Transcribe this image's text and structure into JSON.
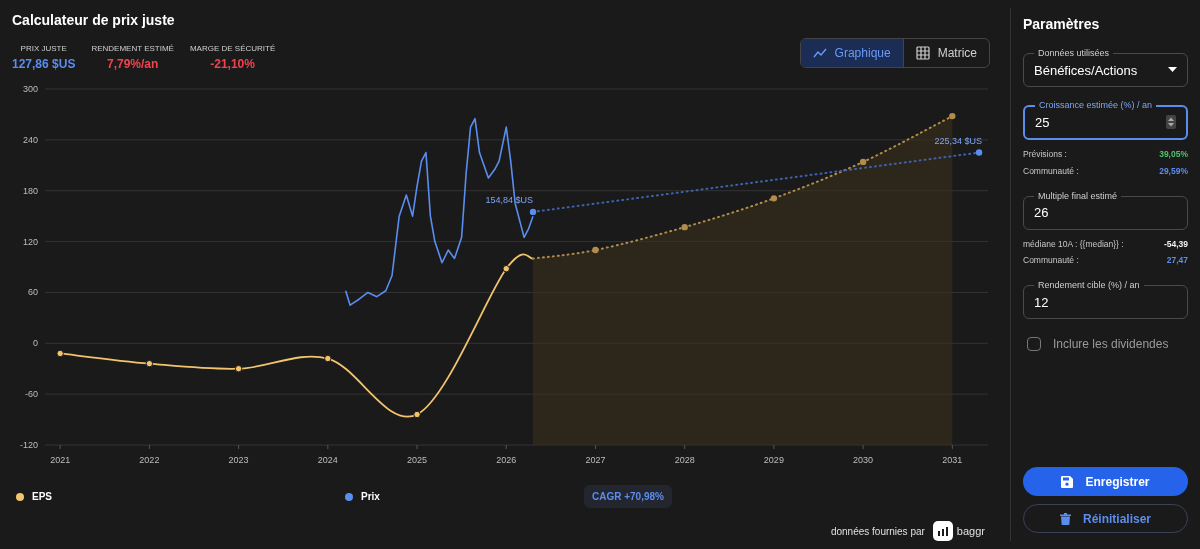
{
  "title": "Calculateur de prix juste",
  "metrics": [
    {
      "label": "PRIX JUSTE",
      "value": "127,86 $US",
      "color": "#5b8def"
    },
    {
      "label": "RENDEMENT ESTIMÉ",
      "value": "7,79%/an",
      "color": "#f0434b"
    },
    {
      "label": "MARGE DE SÉCURITÉ",
      "value": "-21,10%",
      "color": "#f0434b"
    }
  ],
  "view_toggle": [
    {
      "label": "Graphique",
      "kind": "chart",
      "selected": true
    },
    {
      "label": "Matrice",
      "kind": "grid",
      "selected": false
    }
  ],
  "chart_data": {
    "type": "line",
    "grid": true,
    "xlim": [
      2020.83,
      2031.4
    ],
    "ylim": [
      -120,
      300
    ],
    "xticks": [
      2021,
      2022,
      2023,
      2024,
      2025,
      2026,
      2027,
      2028,
      2029,
      2030,
      2031
    ],
    "yticks": [
      -120,
      -60,
      0,
      60,
      120,
      180,
      240,
      300
    ],
    "series": [
      {
        "name": "EPS",
        "color": "#f2c46d",
        "marker": true,
        "x": [
          2021,
          2022,
          2023,
          2024,
          2025,
          2026,
          2026.3
        ],
        "values": [
          -12,
          -24,
          -30,
          -18,
          -84,
          88,
          100
        ]
      },
      {
        "name": "Prix",
        "color": "#5b8def",
        "x": [
          2024.2,
          2024.25,
          2024.35,
          2024.45,
          2024.55,
          2024.65,
          2024.72,
          2024.8,
          2024.88,
          2024.95,
          2025.0,
          2025.05,
          2025.1,
          2025.15,
          2025.2,
          2025.28,
          2025.35,
          2025.42,
          2025.5,
          2025.55,
          2025.6,
          2025.65,
          2025.7,
          2025.75,
          2025.8,
          2025.87,
          2025.92,
          2026.0,
          2026.05,
          2026.1,
          2026.15,
          2026.2,
          2026.25,
          2026.3
        ],
        "values": [
          62,
          45,
          52,
          60,
          55,
          62,
          80,
          150,
          175,
          150,
          185,
          215,
          225,
          150,
          120,
          95,
          110,
          100,
          125,
          200,
          255,
          265,
          225,
          210,
          195,
          205,
          215,
          255,
          215,
          165,
          145,
          125,
          135,
          150
        ]
      },
      {
        "color": "#b08d4a",
        "marker": true,
        "line_style": "dotted",
        "x": [
          2026.3,
          2027,
          2028,
          2029,
          2030,
          2031
        ],
        "values": [
          100,
          110,
          137,
          171,
          214,
          268
        ]
      },
      {
        "color": "#3d63b0",
        "marker": true,
        "line_style": "dotted",
        "x": [
          2026.3,
          2031.3
        ],
        "values": [
          155,
          225
        ]
      }
    ],
    "annotations": [
      {
        "text": "154,84 $US",
        "x": 2026.3,
        "y": 155
      },
      {
        "text": "225,34 $US",
        "x": 2031.3,
        "y": 225
      }
    ]
  },
  "cagr": "CAGR +70,98%",
  "attribution": {
    "text": "données fournies par",
    "brand": "baggr"
  },
  "parameters": {
    "title": "Paramètres",
    "controls": [
      {
        "kind": "select",
        "label": "Données utilisées",
        "value": "Bénéfices/Actions",
        "focused": false
      },
      {
        "kind": "number",
        "label": "Croissance estimée (%) / an",
        "value": "25",
        "focused": true
      },
      {
        "kind": "refs",
        "rows": [
          {
            "label": "Prévisions :",
            "value": "39,05%",
            "color": "#4fc36a"
          },
          {
            "label": "Communauté :",
            "value": "29,59%",
            "color": "#5b8def"
          }
        ]
      },
      {
        "kind": "text",
        "label": "Multiple final estimé",
        "value": "26",
        "focused": false
      },
      {
        "kind": "refs",
        "rows": [
          {
            "label": "médiane 10A : {{median}} :",
            "value": "-54,39",
            "color": "#f0f0f0"
          },
          {
            "label": "Communauté :",
            "value": "27,47",
            "color": "#5b8def"
          }
        ]
      },
      {
        "kind": "text",
        "label": "Rendement cible (%) / an",
        "value": "12",
        "focused": false
      },
      {
        "kind": "checkbox",
        "label": "Inclure les dividendes",
        "checked": false
      }
    ],
    "buttons": [
      {
        "label": "Enregistrer",
        "kind": "primary"
      },
      {
        "label": "Réinitialiser",
        "kind": "secondary"
      }
    ]
  }
}
